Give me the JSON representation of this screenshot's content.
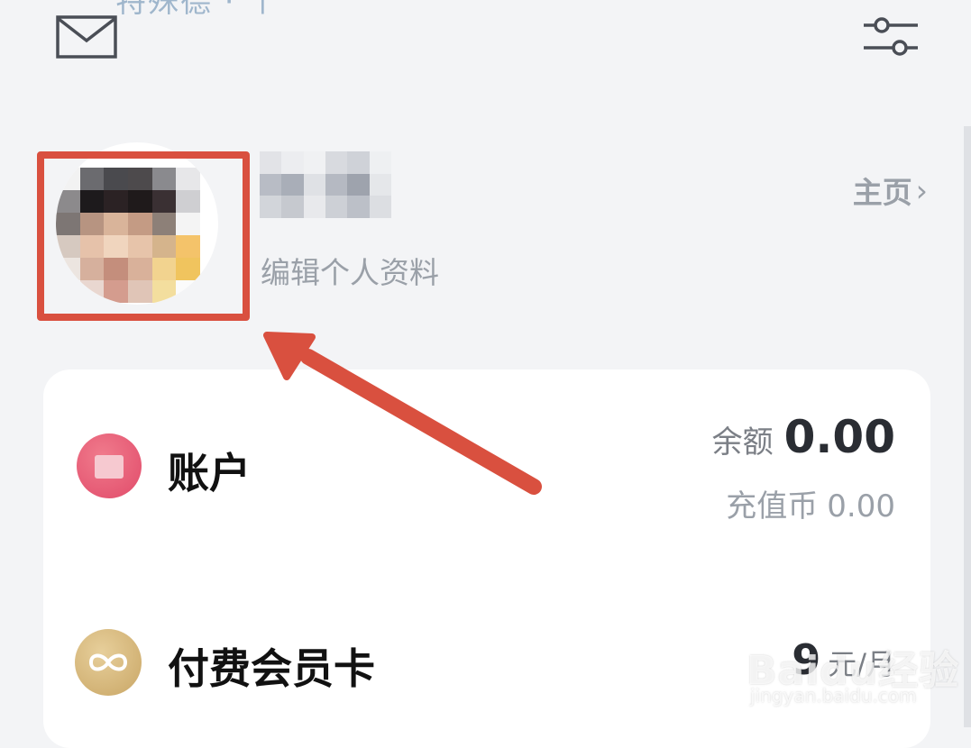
{
  "header": {
    "top_partial_text": "特殊德 · 个",
    "mail_icon": "mail-icon",
    "settings_icon": "filter-sliders-icon"
  },
  "profile": {
    "avatar": "pixelated-avatar",
    "username": "",
    "edit_profile_label": "编辑个人资料",
    "homepage_label": "主页",
    "homepage_chevron": "›"
  },
  "account_card": {
    "account": {
      "icon": "wallet-icon",
      "label": "账户",
      "balance_label": "余额",
      "balance_value": "0.00",
      "coins_label": "充值币",
      "coins_value": "0.00"
    },
    "vip": {
      "icon": "infinity-icon",
      "label": "付费会员卡",
      "price_value": "9",
      "price_unit": "元/月"
    }
  },
  "watermark": {
    "main": "Baidu经验",
    "sub": "jingyan.baidu.com"
  },
  "colors": {
    "highlight": "#d9503f",
    "account_icon": "#e14b6a",
    "vip_icon": "#c9a665",
    "background": "#f3f4f6"
  }
}
